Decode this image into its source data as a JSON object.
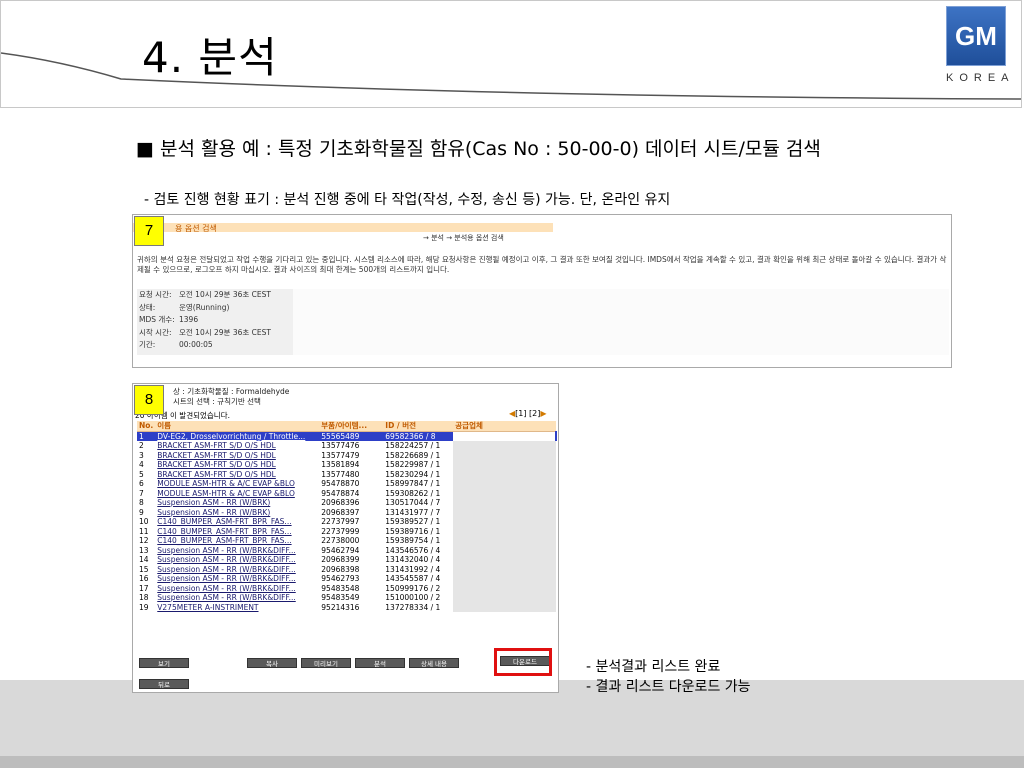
{
  "slide": {
    "title": "4. 분석",
    "logo_mark": "GM",
    "logo_text": "KOREA",
    "bullet1": "■ 분석 활용 예 : 특정 기초화학물질 함유(Cas No : 50-00-0) 데이터 시트/모듈   검색",
    "bullet2": "- 검토 진행 현황 표기 : 분석 진행 중에 타 작업(작성, 수정, 송신 등) 가능. 단, 온라인 유지",
    "note1": "- 분석결과 리스트 완료",
    "note2": "- 결과 리스트 다운로드 가능"
  },
  "colors": {
    "accent_orange": "#fde1b8",
    "highlight_red": "#e01010",
    "selected_row": "#2d3fc7",
    "badge": "#ffff00"
  },
  "screen7": {
    "badge": "7",
    "bar_title": "용 옵션 검색",
    "crumbs": "→ 분석 → 분석용 옵션 검색",
    "message": "귀하의 분석 요청은 전달되었고 작업 수행을 기다리고 있는 중입니다. 시스템 리소스에 따라, 해당 요청사항은 진행될 예정이고 이후, 그 결과 또한 보여질 것입니다. IMDS에서 작업을 계속할 수 있고, 결과 확인을 위해 최근 상태로 돌아갈 수 있습니다. 결과가 삭제될 수 있으므로, 로그오프 하지 마십시오. 결과 사이즈의 최대 한계는 500개의 리스트까지 입니다.",
    "info": [
      {
        "k": "요청 시간:",
        "v": "오전 10시 29분 36초 CEST"
      },
      {
        "k": "상태:",
        "v": "운영(Running)"
      },
      {
        "k": "MDS 개수:",
        "v": "1396"
      },
      {
        "k": "시작 시간:",
        "v": "오전 10시 29분 36초 CEST"
      },
      {
        "k": "기간:",
        "v": "00:00:05"
      }
    ]
  },
  "screen8": {
    "badge": "8",
    "head_line1": "상 :          기초화학물질 : Formaldehyde",
    "head_line2": "시트의 선택 :    규칙기반 선택",
    "found": "20 아이템 이 발견되었습니다.",
    "pager": "[1] [2]",
    "columns": [
      "No.",
      "이름",
      "부품/아이템...",
      "ID / 버전",
      "공급업체"
    ],
    "rows": [
      {
        "no": "1",
        "name": "DV-EG2, Drosselvorrichtung / Throttle...",
        "part": "55565489",
        "id": "69582366 / 8",
        "selected": true
      },
      {
        "no": "2",
        "name": "BRACKET ASM-FRT S/D O/S HDL",
        "part": "13577476",
        "id": "158224257 / 1"
      },
      {
        "no": "3",
        "name": "BRACKET ASM-FRT S/D O/S HDL",
        "part": "13577479",
        "id": "158226689 / 1"
      },
      {
        "no": "4",
        "name": "BRACKET ASM-FRT S/D O/S HDL",
        "part": "13581894",
        "id": "158229987 / 1"
      },
      {
        "no": "5",
        "name": "BRACKET ASM-FRT S/D O/S HDL",
        "part": "13577480",
        "id": "158230294 / 1"
      },
      {
        "no": "6",
        "name": "MODULE ASM-HTR & A/C EVAP &BLO",
        "part": "95478870",
        "id": "158997847 / 1"
      },
      {
        "no": "7",
        "name": "MODULE ASM-HTR & A/C EVAP &BLO",
        "part": "95478874",
        "id": "159308262 / 1"
      },
      {
        "no": "8",
        "name": "Suspension ASM - RR (W/BRK)",
        "part": "20968396",
        "id": "130517044 / 7"
      },
      {
        "no": "9",
        "name": "Suspension ASM - RR (W/BRK)",
        "part": "20968397",
        "id": "131431977 / 7"
      },
      {
        "no": "10",
        "name": "C140_BUMPER_ASM-FRT_BPR_FAS...",
        "part": "22737997",
        "id": "159389527 / 1"
      },
      {
        "no": "11",
        "name": "C140_BUMPER_ASM-FRT_BPR_FAS...",
        "part": "22737999",
        "id": "159389716 / 1"
      },
      {
        "no": "12",
        "name": "C140_BUMPER_ASM-FRT_BPR_FAS...",
        "part": "22738000",
        "id": "159389754 / 1"
      },
      {
        "no": "13",
        "name": "Suspension ASM - RR (W/BRK&DIFF...",
        "part": "95462794",
        "id": "143546576 / 4"
      },
      {
        "no": "14",
        "name": "Suspension ASM - RR (W/BRK&DIFF...",
        "part": "20968399",
        "id": "131432040 / 4"
      },
      {
        "no": "15",
        "name": "Suspension ASM - RR (W/BRK&DIFF...",
        "part": "20968398",
        "id": "131431992 / 4"
      },
      {
        "no": "16",
        "name": "Suspension ASM - RR (W/BRK&DIFF...",
        "part": "95462793",
        "id": "143545587 / 4"
      },
      {
        "no": "17",
        "name": "Suspension ASM - RR (W/BRK&DIFF...",
        "part": "95483548",
        "id": "150999176 / 2"
      },
      {
        "no": "18",
        "name": "Suspension ASM - RR (W/BRK&DIFF...",
        "part": "95483549",
        "id": "151000100 / 2"
      },
      {
        "no": "19",
        "name": "V275METER A-INSTRIMENT",
        "part": "95214316",
        "id": "137278334 / 1"
      }
    ],
    "buttons": {
      "view": "보기",
      "copy": "복사",
      "preview": "미리보기",
      "analyze": "분석",
      "detail": "상세 내용",
      "download": "다운로드",
      "back": "뒤로"
    }
  }
}
